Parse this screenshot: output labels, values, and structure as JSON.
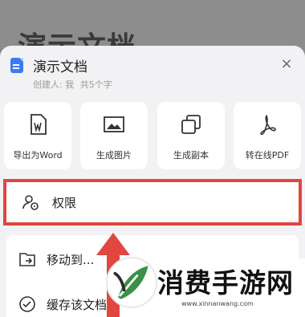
{
  "background": {
    "title": "演示文档"
  },
  "sheet": {
    "title": "演示文档",
    "creator_label": "创建人: 我",
    "word_count": "共5个字",
    "close_glyph": "×",
    "doc_icon": "document-icon",
    "actions": [
      {
        "label": "导出为Word",
        "icon": "word-icon"
      },
      {
        "label": "生成图片",
        "icon": "image-icon"
      },
      {
        "label": "生成副本",
        "icon": "copy-icon"
      },
      {
        "label": "转在线PDF",
        "icon": "pdf-icon"
      }
    ],
    "permission": {
      "label": "权限",
      "icon": "user-permission-icon",
      "highlight_color": "#e1463f"
    },
    "list": [
      {
        "label": "移动到...",
        "icon": "move-folder-icon"
      },
      {
        "label": "缓存该文档",
        "icon": "cache-check-icon"
      }
    ]
  },
  "watermark": {
    "text": "消费手游网",
    "url": "www.xinnanwang.com",
    "logo_text": "A",
    "logo_icon": "leaf-logo-icon"
  },
  "colors": {
    "accent": "#3a7cf0",
    "highlight": "#e1463f",
    "watermark_green": "#3b8f4a"
  }
}
